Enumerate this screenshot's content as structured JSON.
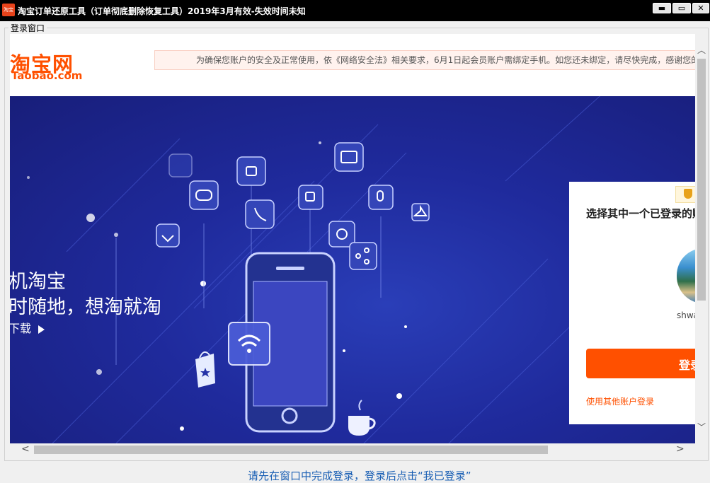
{
  "window": {
    "title": "淘宝订单还原工具（订单彻底删除恢复工具）2019年3月有效-失效时间未知",
    "app_icon_text": "淘宝",
    "minimize_glyph": "▬",
    "maximize_glyph": "▭",
    "close_glyph": "✕"
  },
  "groupbox": {
    "label": "登录窗口"
  },
  "header": {
    "logo_cn": "淘宝网",
    "logo_en": "Taobao.com",
    "notice": "为确保您账户的安全及正常使用，依《网络安全法》相关要求，6月1日起会员账户需绑定手机。如您还未绑定，请尽快完成，感谢您的理解及支持！"
  },
  "banner": {
    "headline_line1": "机淘宝",
    "headline_line2": "时随地，想淘就淘",
    "download_link": "下载"
  },
  "login_card": {
    "title": "选择其中一个已登录的账户",
    "username": "shwa",
    "login_button": "登录",
    "other_accounts": "使用其他账户登录",
    "badge_icon": "shield-icon"
  },
  "footer": {
    "hint": "请先在窗口中完成登录，登录后点击“我已登录”"
  },
  "colors": {
    "brand_orange": "#ff5000",
    "banner_blue": "#1f2a9c",
    "titlebar": "#000000"
  }
}
